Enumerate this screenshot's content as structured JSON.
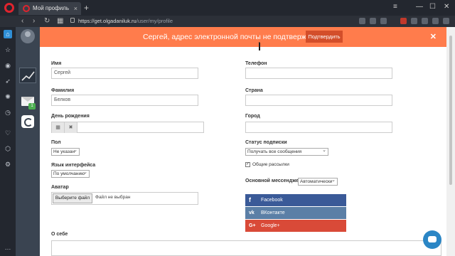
{
  "browser": {
    "tab_title": "Мой профиль",
    "tab_close": "×",
    "new_tab": "+",
    "url_host": "https://get.olgadaniluk.ru",
    "url_path": "/user/my/profile",
    "window_controls": {
      "menu": "≡",
      "minimize": "—",
      "maximize": "☐",
      "close": "✕"
    },
    "nav": {
      "back": "‹",
      "forward": "›",
      "reload": "↻",
      "speed_dial": "▦"
    },
    "sidebar_icons": [
      "home-icon",
      "star-icon",
      "messenger-icon",
      "rocket-icon",
      "settings-icon",
      "clock-icon",
      "heart-icon",
      "cube-icon",
      "gear-icon",
      "more-icon"
    ],
    "more_label": "…"
  },
  "site_nav": {
    "badge_count": "1"
  },
  "banner": {
    "text": "Сергей, адрес электронной почты не подтвержден",
    "confirm_label": "Подтвердить",
    "close_label": "✕"
  },
  "form": {
    "name_label": "Имя",
    "name_value": "Сергей",
    "surname_label": "Фамилия",
    "surname_value": "Белков",
    "birthday_label": "День рождения",
    "birthday_cal_icon": "▦",
    "birthday_clear_icon": "✖",
    "gender_label": "Пол",
    "gender_value": "Не указан",
    "language_label": "Язык интерфейса",
    "language_value": "По умолчанию",
    "avatar_label": "Аватар",
    "file_button": "Выберите файл",
    "file_status": "Файл не выбран",
    "about_label": "О себе",
    "phone_label": "Телефон",
    "country_label": "Страна",
    "city_label": "Город",
    "subscription_label": "Статус подписки",
    "subscription_value": "Получать все сообщения",
    "newsletter_label": "Общие рассылки",
    "messenger_label": "Основной мессенджер",
    "messenger_value": "Автоматически"
  },
  "social": {
    "facebook": "Facebook",
    "facebook_icon": "f",
    "vk": "ВКонтакте",
    "vk_icon": "vk",
    "google": "Google+",
    "google_icon": "G+"
  }
}
